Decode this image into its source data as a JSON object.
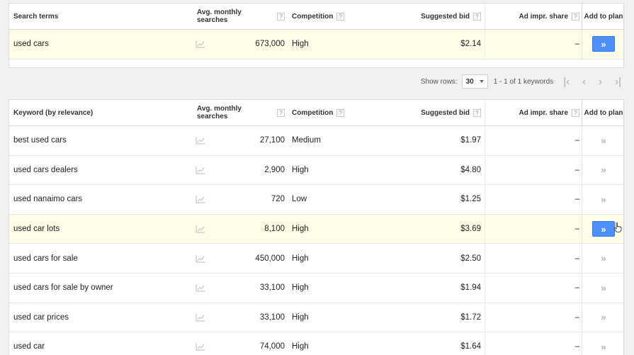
{
  "search_table": {
    "headers": {
      "keyword": "Search terms",
      "avg": "Avg. monthly searches",
      "competition": "Competition",
      "bid": "Suggested bid",
      "impr": "Ad impr. share",
      "add": "Add to plan"
    },
    "row": {
      "keyword": "used cars",
      "avg": "673,000",
      "competition": "High",
      "bid": "$2.14",
      "impr": "–"
    }
  },
  "pager": {
    "show_rows_label": "Show rows:",
    "rows_value": "30",
    "range": "1 - 1 of 1 keywords"
  },
  "keyword_table": {
    "headers": {
      "keyword": "Keyword (by relevance)",
      "avg": "Avg. monthly searches",
      "competition": "Competition",
      "bid": "Suggested bid",
      "impr": "Ad impr. share",
      "add": "Add to plan"
    },
    "rows": [
      {
        "keyword": "best used cars",
        "avg": "27,100",
        "competition": "Medium",
        "bid": "$1.97",
        "impr": "–"
      },
      {
        "keyword": "used cars dealers",
        "avg": "2,900",
        "competition": "High",
        "bid": "$4.80",
        "impr": "–"
      },
      {
        "keyword": "used nanaimo cars",
        "avg": "720",
        "competition": "Low",
        "bid": "$1.25",
        "impr": "–"
      },
      {
        "keyword": "used car lots",
        "avg": "8,100",
        "competition": "High",
        "bid": "$3.69",
        "impr": "–"
      },
      {
        "keyword": "used cars for sale",
        "avg": "450,000",
        "competition": "High",
        "bid": "$2.50",
        "impr": "–"
      },
      {
        "keyword": "used cars for sale by owner",
        "avg": "33,100",
        "competition": "High",
        "bid": "$1.94",
        "impr": "–"
      },
      {
        "keyword": "used car prices",
        "avg": "33,100",
        "competition": "High",
        "bid": "$1.72",
        "impr": "–"
      },
      {
        "keyword": "used car",
        "avg": "74,000",
        "competition": "High",
        "bid": "$1.64",
        "impr": "–"
      }
    ]
  },
  "icons": {
    "help": "?",
    "add": "»",
    "trend": "line-chart-icon"
  },
  "colors": {
    "add_button": "#4d90fe",
    "highlight_row": "#fdfde8"
  }
}
